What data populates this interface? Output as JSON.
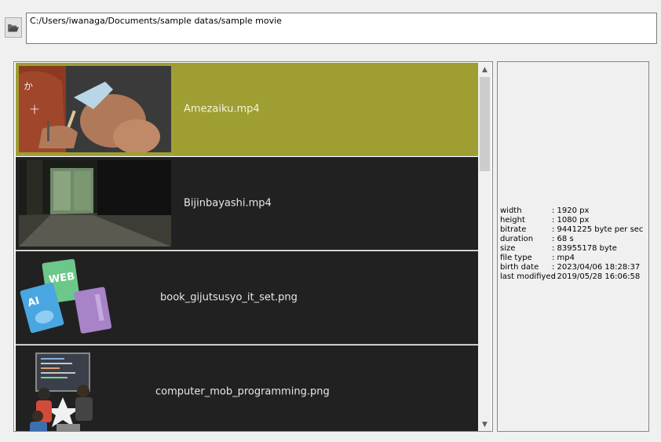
{
  "path": {
    "value": "C:/Users/iwanaga/Documents/sample datas/sample movie"
  },
  "files": [
    {
      "name": "Amezaiku.mp4",
      "selected": true
    },
    {
      "name": "Bijinbayashi.mp4",
      "selected": false
    },
    {
      "name": "book_gijutsusyo_it_set.png",
      "selected": false
    },
    {
      "name": "computer_mob_programming.png",
      "selected": false
    }
  ],
  "info": [
    {
      "key": "width",
      "value": ": 1920 px"
    },
    {
      "key": "height",
      "value": ": 1080 px"
    },
    {
      "key": "bitrate",
      "value": ": 9441225 byte per sec"
    },
    {
      "key": "duration",
      "value": ": 68 s"
    },
    {
      "key": "size",
      "value": ": 83955178 byte"
    },
    {
      "key": "file type",
      "value": ": mp4"
    },
    {
      "key": "birth date",
      "value": ": 2023/04/06 18:28:37"
    },
    {
      "key": "last modifiyed",
      "value": ": 2019/05/28 16:06:58"
    }
  ],
  "icons": {
    "open_folder": "folder-open-icon",
    "scroll_up": "chevron-up-icon",
    "scroll_down": "chevron-down-icon"
  },
  "colors": {
    "list_background": "#212121",
    "selected_background": "#9e9e33",
    "text_light": "#e8e8e8"
  }
}
